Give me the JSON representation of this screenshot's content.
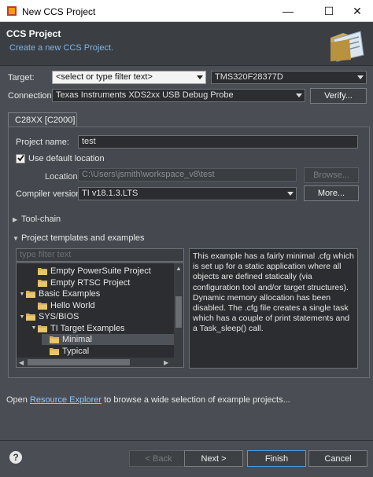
{
  "window": {
    "title": "New CCS Project",
    "minimize": "—",
    "maximize": "☐",
    "close": "✕"
  },
  "header": {
    "title": "CCS Project",
    "subtitle": "Create a new CCS Project."
  },
  "target": {
    "label": "Target:",
    "filter_placeholder": "<select or type filter text>",
    "device": "TMS320F28377D"
  },
  "connection": {
    "label": "Connection:",
    "value": "Texas Instruments XDS2xx USB Debug Probe",
    "verify_label": "Verify..."
  },
  "tab": {
    "label": "C28XX [C2000]"
  },
  "project": {
    "name_label": "Project name:",
    "name_value": "test",
    "use_default_label": "Use default location",
    "use_default_checked": true,
    "location_label": "Location:",
    "location_value": "C:\\Users\\jsmith\\workspace_v8\\test",
    "browse_label": "Browse...",
    "compiler_label": "Compiler version:",
    "compiler_value": "TI v18.1.3.LTS",
    "more_label": "More..."
  },
  "toolchain": {
    "label": "Tool-chain"
  },
  "templates": {
    "label": "Project templates and examples",
    "filter_placeholder": "type filter text",
    "tree": [
      {
        "label": "Empty PowerSuite Project",
        "indent": 2,
        "expander": "",
        "folder": true,
        "selected": false
      },
      {
        "label": "Empty RTSC Project",
        "indent": 2,
        "expander": "",
        "folder": true,
        "selected": false
      },
      {
        "label": "Basic Examples",
        "indent": 1,
        "expander": "▼",
        "folder": true,
        "selected": false
      },
      {
        "label": "Hello World",
        "indent": 2,
        "expander": "",
        "folder": true,
        "selected": false
      },
      {
        "label": "SYS/BIOS",
        "indent": 1,
        "expander": "▼",
        "folder": true,
        "selected": false
      },
      {
        "label": "TI Target Examples",
        "indent": 2,
        "expander": "▼",
        "folder": true,
        "selected": false
      },
      {
        "label": "Minimal",
        "indent": 3,
        "expander": "",
        "folder": true,
        "selected": true
      },
      {
        "label": "Typical",
        "indent": 3,
        "expander": "",
        "folder": true,
        "selected": false
      }
    ],
    "description": "This example has a fairly minimal .cfg which is set up for a static application where all objects are defined statically (via configuration tool and/or target structures). Dynamic memory allocation has been disabled. The .cfg file creates a single task which has a couple of print statements and a Task_sleep() call."
  },
  "resource": {
    "prefix": "Open ",
    "link": "Resource Explorer",
    "suffix": " to browse a wide selection of example projects..."
  },
  "footer": {
    "help": "?",
    "back": "< Back",
    "next": "Next >",
    "finish": "Finish",
    "cancel": "Cancel"
  },
  "colors": {
    "background": "#4a4e54",
    "header": "#3b3f44",
    "link": "#8cc4ff",
    "accent": "#4d9be0"
  }
}
